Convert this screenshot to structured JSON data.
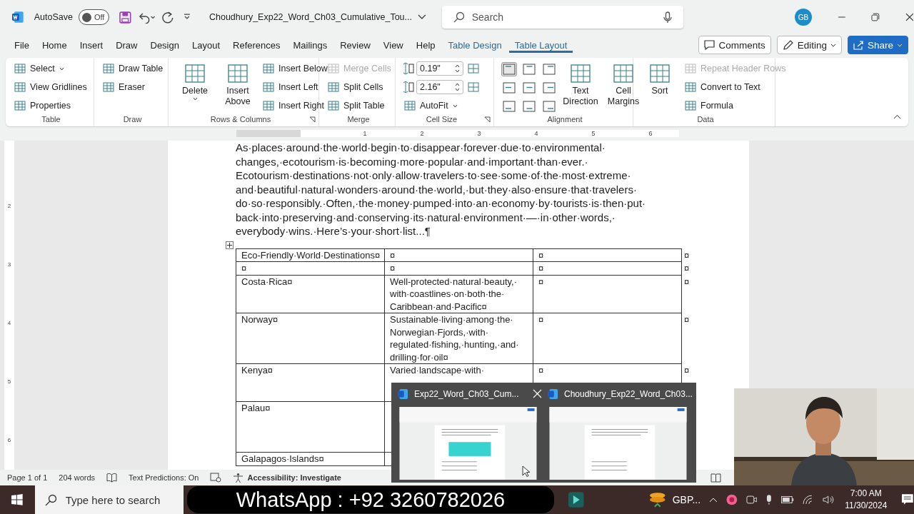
{
  "titlebar": {
    "autosave_label": "AutoSave",
    "autosave": {
      "label": "Off",
      "on": false
    },
    "document_title": "Choudhury_Exp22_Word_Ch03_Cumulative_Tou...",
    "search": {
      "placeholder": "Search"
    },
    "avatar": "GB"
  },
  "menu_tabs": [
    {
      "label": "File",
      "kind": "plain",
      "selected": false
    },
    {
      "label": "Home",
      "kind": "plain",
      "selected": false
    },
    {
      "label": "Insert",
      "kind": "plain",
      "selected": false
    },
    {
      "label": "Draw",
      "kind": "plain",
      "selected": false
    },
    {
      "label": "Design",
      "kind": "plain",
      "selected": false
    },
    {
      "label": "Layout",
      "kind": "plain",
      "selected": false
    },
    {
      "label": "References",
      "kind": "plain",
      "selected": false
    },
    {
      "label": "Mailings",
      "kind": "plain",
      "selected": false
    },
    {
      "label": "Review",
      "kind": "plain",
      "selected": false
    },
    {
      "label": "View",
      "kind": "plain",
      "selected": false
    },
    {
      "label": "Help",
      "kind": "plain",
      "selected": false
    },
    {
      "label": "Table Design",
      "kind": "contextual",
      "selected": false
    },
    {
      "label": "Table Layout",
      "kind": "contextual",
      "selected": true
    }
  ],
  "header_buttons": {
    "comments": "Comments",
    "editing": "Editing",
    "share": "Share"
  },
  "ribbon_groups": [
    {
      "label": "Table",
      "columns": [
        [
          {
            "label": "Select",
            "kind": "small",
            "dropdown": true,
            "disabled": false
          },
          {
            "label": "View Gridlines",
            "kind": "small",
            "disabled": false
          },
          {
            "label": "Properties",
            "kind": "small",
            "disabled": false
          }
        ]
      ]
    },
    {
      "label": "Draw",
      "columns": [
        [
          {
            "label": "Draw Table",
            "kind": "small",
            "disabled": false
          },
          {
            "label": "Eraser",
            "kind": "small",
            "disabled": false
          }
        ]
      ]
    },
    {
      "label": "Rows & Columns",
      "launcher": true,
      "columns": [
        [
          {
            "label": "Delete",
            "kind": "large",
            "dropdown": true,
            "disabled": false
          }
        ],
        [
          {
            "label": "Insert Above",
            "kind": "large",
            "disabled": false
          }
        ],
        [
          {
            "label": "Insert Below",
            "kind": "small",
            "disabled": false
          },
          {
            "label": "Insert Left",
            "kind": "small",
            "disabled": false
          },
          {
            "label": "Insert Right",
            "kind": "small",
            "disabled": false
          }
        ]
      ]
    },
    {
      "label": "Merge",
      "columns": [
        [
          {
            "label": "Merge Cells",
            "kind": "small",
            "disabled": true
          },
          {
            "label": "Split Cells",
            "kind": "small",
            "disabled": false
          },
          {
            "label": "Split Table",
            "kind": "small",
            "disabled": false
          }
        ]
      ]
    },
    {
      "label": "Cell Size",
      "launcher": true,
      "columns": [
        [
          {
            "value": "0.19\"",
            "kind": "spin"
          },
          {
            "value": "2.16\"",
            "kind": "spin"
          },
          {
            "label": "AutoFit",
            "kind": "small",
            "dropdown": true,
            "disabled": false
          }
        ],
        [
          {
            "kind": "icon"
          },
          {
            "kind": "icon"
          }
        ]
      ]
    },
    {
      "label": "Alignment",
      "columns": [
        [
          {
            "kind": "align",
            "selected": true
          },
          {
            "kind": "align",
            "selected": false
          },
          {
            "kind": "align",
            "selected": false
          }
        ],
        [
          {
            "kind": "align",
            "selected": false
          },
          {
            "kind": "align",
            "selected": false
          },
          {
            "kind": "align",
            "selected": false
          }
        ],
        [
          {
            "kind": "align",
            "selected": false
          },
          {
            "kind": "align",
            "selected": false
          },
          {
            "kind": "align",
            "selected": false
          }
        ],
        [
          {
            "label": "Text Direction",
            "kind": "large",
            "disabled": false
          }
        ],
        [
          {
            "label": "Cell Margins",
            "kind": "large",
            "disabled": false
          }
        ]
      ]
    },
    {
      "label": "Data",
      "columns": [
        [
          {
            "label": "Sort",
            "kind": "large",
            "disabled": false
          }
        ],
        [
          {
            "label": "Repeat Header Rows",
            "kind": "small",
            "disabled": true
          },
          {
            "label": "Convert to Text",
            "kind": "small",
            "disabled": false
          },
          {
            "label": "Formula",
            "kind": "small",
            "disabled": false
          }
        ]
      ]
    }
  ],
  "ruler": {
    "labels": [
      "1",
      "2",
      "3",
      "4",
      "5",
      "6"
    ],
    "vertical_labels": [
      "2",
      "3",
      "4",
      "5",
      "6"
    ]
  },
  "document": {
    "paragraph_lines": [
      "As·places·around·the·world·begin·to·disappear·forever·due·to·environmental·",
      "changes,·ecotourism·is·becoming·more·popular·and·important·than·ever.·",
      "Ecotourism·destinations·not·only·allow·travelers·to·see·some·of·the·most·extreme·",
      "and·beautiful·natural·wonders·around·the·world,·but·they·also·ensure·that·travelers·",
      "do·so·responsibly.·Often,·the·money·pumped·into·an·economy·by·tourists·is·then·put·",
      "back·into·preserving·and·conserving·its·natural·environment·—·in·other·words,·",
      "everybody·wins.·Here’s·your·short·list...¶"
    ],
    "table": {
      "rows": [
        {
          "cells": [
            [
              "Eco-Friendly·World·Destinations¤"
            ],
            [
              "¤"
            ],
            [
              "¤"
            ]
          ],
          "end_mark": "¤"
        },
        {
          "cells": [
            [
              "¤"
            ],
            [
              "¤"
            ],
            [
              "¤"
            ]
          ],
          "end_mark": "¤"
        },
        {
          "cells": [
            [
              "Costa·Rica¤"
            ],
            [
              "Well-protected·natural·beauty,·",
              "with·coastlines·on·both·the·",
              "Caribbean·and·Pacific¤"
            ],
            [
              "¤"
            ]
          ],
          "end_mark": "¤"
        },
        {
          "cells": [
            [
              "Norway¤"
            ],
            [
              "Sustainable·living·among·the·",
              "Norwegian·Fjords,·with·",
              "regulated·fishing,·hunting,·and·",
              "drilling·for·oil¤"
            ],
            [
              "¤"
            ]
          ],
          "end_mark": "¤"
        },
        {
          "cells": [
            [
              "Kenya¤"
            ],
            [
              "Varied·landscape·with·"
            ],
            [
              "¤"
            ]
          ],
          "end_mark": "¤"
        },
        {
          "cells": [
            [
              "Palau¤"
            ]
          ]
        },
        {
          "cells": [
            [
              "Galapagos·Islands¤"
            ]
          ]
        }
      ]
    }
  },
  "status_bar": {
    "page": "Page 1 of 1",
    "words": "204 words",
    "predictions": "Text Predictions: On",
    "accessibility": "Accessibility: Investigate"
  },
  "taskbar": {
    "search": {
      "placeholder": "Type here to search"
    },
    "app_label": "GBP...",
    "time": "7:00 AM",
    "date": "11/30/2024"
  },
  "thumbnail_popup": {
    "items": [
      {
        "title": "Exp22_Word_Ch03_Cum...",
        "closable": true
      },
      {
        "title": "Choudhury_Exp22_Word_Ch03..."
      }
    ]
  },
  "banner": "WhatsApp : +92 3260782026"
}
